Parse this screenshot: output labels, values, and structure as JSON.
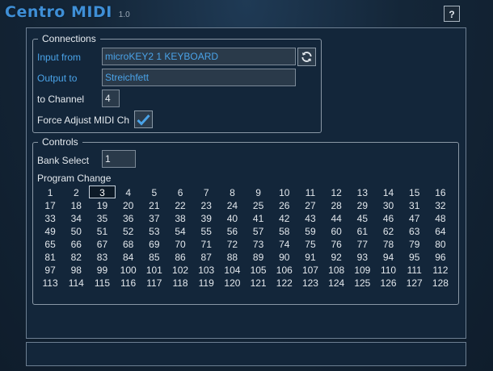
{
  "app": {
    "title": "Centro MIDI",
    "version": "1.0",
    "help_label": "?"
  },
  "connections": {
    "legend": "Connections",
    "input_label": "Input from",
    "input_value": "microKEY2 1 KEYBOARD",
    "output_label": "Output to",
    "output_value": "Streichfett",
    "channel_label": "to Channel",
    "channel_value": "4",
    "force_label": "Force Adjust MIDI Ch",
    "force_checked": true,
    "refresh_icon": "refresh-icon"
  },
  "controls": {
    "legend": "Controls",
    "bank_label": "Bank Select",
    "bank_value": "1",
    "program_label": "Program Change",
    "selected_program": 3,
    "programs": [
      "1",
      "2",
      "3",
      "4",
      "5",
      "6",
      "7",
      "8",
      "9",
      "10",
      "11",
      "12",
      "13",
      "14",
      "15",
      "16",
      "17",
      "18",
      "19",
      "20",
      "21",
      "22",
      "23",
      "24",
      "25",
      "26",
      "27",
      "28",
      "29",
      "30",
      "31",
      "32",
      "33",
      "34",
      "35",
      "36",
      "37",
      "38",
      "39",
      "40",
      "41",
      "42",
      "43",
      "44",
      "45",
      "46",
      "47",
      "48",
      "49",
      "50",
      "51",
      "52",
      "53",
      "54",
      "55",
      "56",
      "57",
      "58",
      "59",
      "60",
      "61",
      "62",
      "63",
      "64",
      "65",
      "66",
      "67",
      "68",
      "69",
      "70",
      "71",
      "72",
      "73",
      "74",
      "75",
      "76",
      "77",
      "78",
      "79",
      "80",
      "81",
      "82",
      "83",
      "84",
      "85",
      "86",
      "87",
      "88",
      "89",
      "90",
      "91",
      "92",
      "93",
      "94",
      "95",
      "96",
      "97",
      "98",
      "99",
      "100",
      "101",
      "102",
      "103",
      "104",
      "105",
      "106",
      "107",
      "108",
      "109",
      "110",
      "111",
      "112",
      "113",
      "114",
      "115",
      "116",
      "117",
      "118",
      "119",
      "120",
      "121",
      "122",
      "123",
      "124",
      "125",
      "126",
      "127",
      "128"
    ]
  },
  "colors": {
    "accent": "#4aa3e8",
    "title": "#3f8fd6",
    "background": "#13263a"
  }
}
